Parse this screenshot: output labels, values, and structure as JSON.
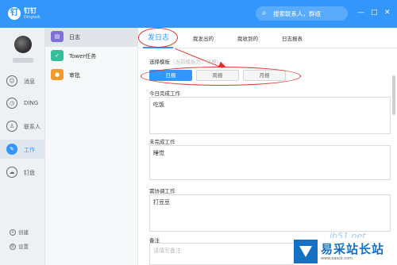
{
  "app": {
    "logo_char": "钉",
    "name": "钉钉",
    "sub": "Dingtalk"
  },
  "search": {
    "icon": "search-icon",
    "placeholder": "搜索联系人，群组"
  },
  "window_controls": [
    "—",
    "□",
    "✕"
  ],
  "nav": {
    "items": [
      {
        "label": "消息",
        "icon": "chat-icon",
        "glyph": "☺"
      },
      {
        "label": "DING",
        "icon": "ding-icon",
        "glyph": "◷"
      },
      {
        "label": "联系人",
        "icon": "contacts-icon",
        "glyph": "♙"
      },
      {
        "label": "工作",
        "icon": "work-icon",
        "glyph": "✎",
        "active": true
      },
      {
        "label": "钉盘",
        "icon": "cloud-drive-icon",
        "glyph": "☁"
      }
    ],
    "bottom": [
      {
        "label": "创建",
        "glyph": "+"
      },
      {
        "label": "设置",
        "glyph": "⚙"
      }
    ]
  },
  "apps": [
    {
      "label": "日志",
      "icon": "log-icon",
      "glyph": "▤",
      "color": "#7d6fd8",
      "active": true
    },
    {
      "label": "Tower任务",
      "icon": "tower-check-icon",
      "glyph": "✓",
      "color": "#35c09a"
    },
    {
      "label": "审批",
      "icon": "approval-icon",
      "glyph": "●",
      "color": "#f39a2b"
    }
  ],
  "tabs": [
    "发日志",
    "我发出的",
    "我收到的",
    "日志报表"
  ],
  "template": {
    "label": "选择模板",
    "hint": "（当前模板为：日报）",
    "options": [
      "日报",
      "周报",
      "月报"
    ],
    "selected": "日报"
  },
  "fields": [
    {
      "label": "今日完成工作",
      "value": "吃饭",
      "placeholder": false
    },
    {
      "label": "未完成工作",
      "value": "睡觉",
      "placeholder": false
    },
    {
      "label": "需协调工作",
      "value": "打豆豆",
      "placeholder": false
    },
    {
      "label": "备注",
      "value": "请填写备注",
      "placeholder": true
    }
  ],
  "watermark": {
    "url": "jb51.net",
    "brand": "易采站长站",
    "sub": "www.easck.com"
  },
  "colors": {
    "brand": "#3296fa",
    "annotation": "#d9342b"
  }
}
